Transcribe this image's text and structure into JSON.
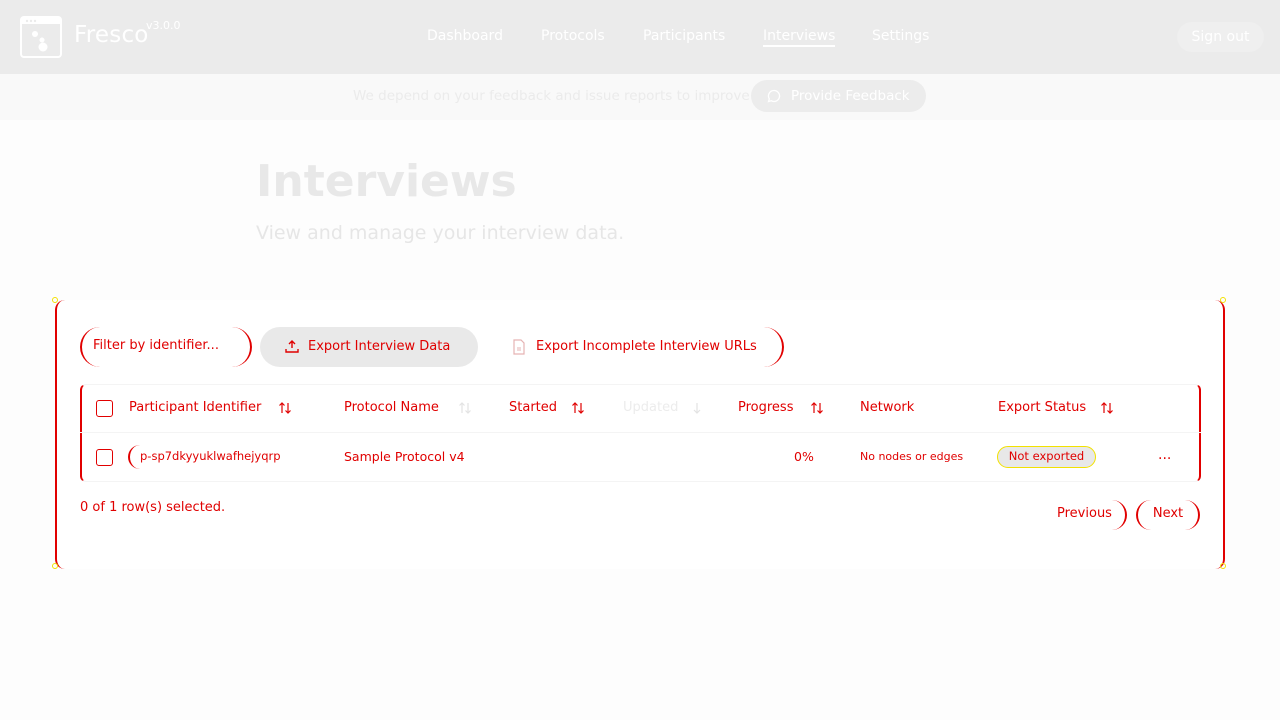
{
  "app": {
    "brand": "Fresco",
    "version": "v3.0.0",
    "nav": [
      {
        "label": "Dashboard",
        "active": false
      },
      {
        "label": "Protocols",
        "active": false
      },
      {
        "label": "Participants",
        "active": false
      },
      {
        "label": "Interviews",
        "active": true
      },
      {
        "label": "Settings",
        "active": false
      }
    ],
    "signout_label": "Sign out"
  },
  "feedback": {
    "text": "We depend on your feedback and issue reports to improve",
    "button_label": "Provide Feedback"
  },
  "page": {
    "title": "Interviews",
    "subtitle": "View and manage your interview data."
  },
  "toolbar": {
    "filter_placeholder": "Filter by identifier...",
    "export_label": "Export Interview Data",
    "export_urls_label": "Export Incomplete Interview URLs"
  },
  "table": {
    "columns": [
      {
        "label": "Participant Identifier",
        "sort": "both"
      },
      {
        "label": "Protocol Name",
        "sort": "both"
      },
      {
        "label": "Started",
        "sort": "both"
      },
      {
        "label": "Updated",
        "sort": "desc"
      },
      {
        "label": "Progress",
        "sort": "both"
      },
      {
        "label": "Network",
        "sort": "none"
      },
      {
        "label": "Export Status",
        "sort": "both"
      }
    ],
    "rows": [
      {
        "participant": "p-sp7dkyyuklwafhejyqrp",
        "protocol": "Sample Protocol v4",
        "started": "",
        "updated": "",
        "progress": "0%",
        "network": "No nodes or edges",
        "export_status": "Not exported",
        "actions": "..."
      }
    ]
  },
  "footer": {
    "selected_text": "0 of 1 row(s) selected.",
    "previous_label": "Previous",
    "next_label": "Next"
  },
  "colors": {
    "nav_bg": "#ebebeb",
    "highlight_red": "#e10000",
    "highlight_yellow": "#f2e100"
  }
}
